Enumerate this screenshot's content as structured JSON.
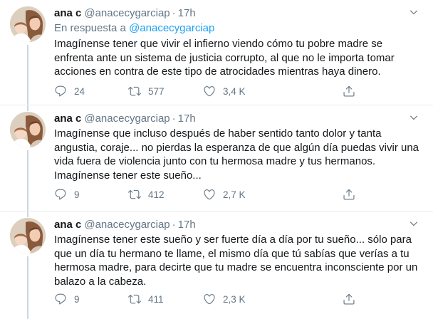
{
  "tweets": [
    {
      "name": "ana c",
      "handle": "@anacecygarciap",
      "separator": "·",
      "time": "17h",
      "reply_prefix": "En respuesta a ",
      "reply_handle": "@anacecygarciap",
      "text": "Imagínense tener que vivir el infierno viendo cómo tu pobre madre se\nenfrenta ante un sistema de justicia corrupto, al que no le importa tomar\nacciones en contra de este tipo de atrocidades mientras haya dinero.",
      "replies": "24",
      "retweets": "577",
      "likes": "3,4 K"
    },
    {
      "name": "ana c",
      "handle": "@anacecygarciap",
      "separator": "·",
      "time": "17h",
      "text": "Imagínense que incluso después de haber sentido tanto dolor y tanta\nangustia, coraje... no pierdas la esperanza de que algún día puedas vivir una\nvida fuera de violencia junto con tu hermosa madre y tus hermanos.\nImagínense tener este sueño...",
      "replies": "9",
      "retweets": "412",
      "likes": "2,7 K"
    },
    {
      "name": "ana c",
      "handle": "@anacecygarciap",
      "separator": "·",
      "time": "17h",
      "text": "Imagínense tener este sueño y ser fuerte día a día por tu sueño... sólo para\nque un día tu hermano te llame, el mismo día que tú sabías que verías a tu\nhermosa madre, para decirte que tu madre se encuentra inconsciente por un\nbalazo a la cabeza.",
      "replies": "9",
      "retweets": "411",
      "likes": "2,3 K"
    }
  ],
  "icons": {
    "reply": "reply-icon",
    "retweet": "retweet-icon",
    "like": "heart-icon",
    "share": "share-icon",
    "menu": "chevron-down-icon"
  },
  "colors": {
    "text": "#14171a",
    "secondary": "#657786",
    "link": "#1da1f2",
    "divider": "#e6ecf0",
    "thread_line": "#ccd6dd"
  }
}
